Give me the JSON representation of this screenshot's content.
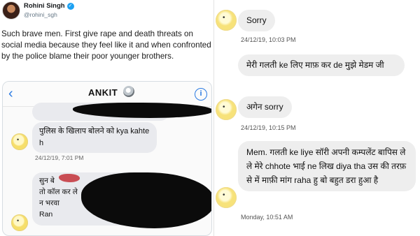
{
  "tweet": {
    "author_name": "Rohini Singh",
    "verified_mark": "✓",
    "handle": "@rohini_sgh",
    "text": "Such brave men. First give rape and death threats on social media because they feel like it and when confronted by the police blame their poor younger brothers."
  },
  "embedded_chat": {
    "back_icon": "‹",
    "contact_name": "ANKIT",
    "info_icon": "i",
    "messages": [
      {
        "text": "पुलिस के खिलाप बोलने को kya kahte h"
      },
      {
        "timestamp": "24/12/19, 7:01 PM"
      },
      {
        "lines": [
          "सुन बे",
          "तो कॉल कर ले",
          "न भरवा",
          "Ran"
        ]
      }
    ]
  },
  "right_chat": {
    "messages": [
      {
        "text": "Sorry",
        "timestamp": "24/12/19, 10:03 PM"
      },
      {
        "text": "मेरी गलती ke लिए माफ़ कर de मुझे मेडम जी"
      },
      {
        "text": "अगेन sorry",
        "timestamp": "24/12/19, 10:15 PM"
      },
      {
        "text": "Mem. गलती ke liye सॉरी अपनी कम्पलेंट बापिस ले ले मेरे chhote भाई ne लिख diya tha उस की तरफ़ से में माफ़ी मांग  raha हु बो बहुत डरा हुआ है",
        "timestamp": "Monday, 10:51 AM"
      }
    ]
  },
  "colors": {
    "link_blue": "#2a7ae2",
    "verified_blue": "#1da1f2",
    "bubble_grey": "#eeeeee"
  }
}
